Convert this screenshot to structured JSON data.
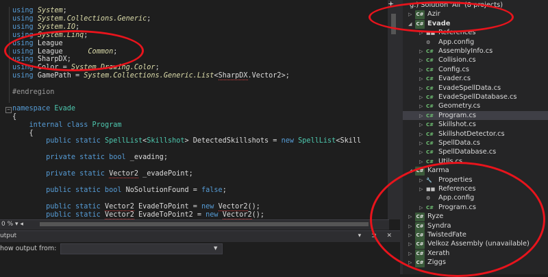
{
  "editor": {
    "lines": [
      [
        {
          "t": "using ",
          "c": "kw"
        },
        {
          "t": "System",
          "c": "ns"
        },
        {
          "t": ";",
          "c": "df"
        }
      ],
      [
        {
          "t": "using ",
          "c": "kw"
        },
        {
          "t": "System.Collections.Generic",
          "c": "ns"
        },
        {
          "t": ";",
          "c": "df"
        }
      ],
      [
        {
          "t": "using ",
          "c": "kw"
        },
        {
          "t": "System.IO",
          "c": "ns"
        },
        {
          "t": ";",
          "c": "df"
        }
      ],
      [
        {
          "t": "using ",
          "c": "kw"
        },
        {
          "t": "System.Linq",
          "c": "ns"
        },
        {
          "t": ";",
          "c": "df"
        }
      ],
      [
        {
          "t": "using ",
          "c": "kw"
        },
        {
          "t": "League",
          "c": "df"
        }
      ],
      [
        {
          "t": "using ",
          "c": "kw"
        },
        {
          "t": "League      ",
          "c": "df"
        },
        {
          "t": "Common",
          "c": "ns"
        },
        {
          "t": ";",
          "c": "df"
        }
      ],
      [
        {
          "t": "using ",
          "c": "kw"
        },
        {
          "t": "SharpDX",
          "c": "df"
        },
        {
          "t": ";",
          "c": "df"
        }
      ],
      [
        {
          "t": "using ",
          "c": "kw"
        },
        {
          "t": "Color = ",
          "c": "df"
        },
        {
          "t": "System.Drawing.Color",
          "c": "ns"
        },
        {
          "t": ";",
          "c": "df"
        }
      ],
      [
        {
          "t": "using ",
          "c": "kw"
        },
        {
          "t": "GamePath = ",
          "c": "df"
        },
        {
          "t": "System.Collections.Generic.List",
          "c": "ns"
        },
        {
          "t": "<",
          "c": "df"
        },
        {
          "t": "SharpDX",
          "c": "df",
          "u": true
        },
        {
          "t": ".Vector2>;",
          "c": "df"
        }
      ],
      [],
      [
        {
          "t": "#endregion",
          "c": "cm"
        }
      ],
      [],
      [
        {
          "t": "namespace ",
          "c": "kw"
        },
        {
          "t": "Evade",
          "c": "ty"
        }
      ],
      [
        {
          "t": "{",
          "c": "df"
        }
      ],
      [
        {
          "t": "    internal class ",
          "c": "kw"
        },
        {
          "t": "Program",
          "c": "ty"
        }
      ],
      [
        {
          "t": "    {",
          "c": "df"
        }
      ],
      [
        {
          "t": "        public static ",
          "c": "kw"
        },
        {
          "t": "SpellList",
          "c": "ty"
        },
        {
          "t": "<",
          "c": "df"
        },
        {
          "t": "Skillshot",
          "c": "ty"
        },
        {
          "t": "> DetectedSkillshots = ",
          "c": "df"
        },
        {
          "t": "new ",
          "c": "kw"
        },
        {
          "t": "SpellList",
          "c": "ty"
        },
        {
          "t": "<Skill",
          "c": "df"
        }
      ],
      [],
      [
        {
          "t": "        private static bool ",
          "c": "kw"
        },
        {
          "t": "_evading;",
          "c": "df"
        }
      ],
      [],
      [
        {
          "t": "        private static ",
          "c": "kw"
        },
        {
          "t": "Vector2",
          "c": "df",
          "u": true
        },
        {
          "t": " _evadePoint;",
          "c": "df"
        }
      ],
      [],
      [
        {
          "t": "        public static bool ",
          "c": "kw"
        },
        {
          "t": "NoSolutionFound = ",
          "c": "df"
        },
        {
          "t": "false",
          "c": "kw"
        },
        {
          "t": ";",
          "c": "df"
        }
      ],
      [],
      [
        {
          "t": "        public static ",
          "c": "kw"
        },
        {
          "t": "Vector2",
          "c": "df",
          "u": true
        },
        {
          "t": " EvadeToPoint = ",
          "c": "df"
        },
        {
          "t": "new ",
          "c": "kw"
        },
        {
          "t": "Vector2",
          "c": "df",
          "u": true
        },
        {
          "t": "();",
          "c": "df"
        }
      ],
      [
        {
          "t": "        public static ",
          "c": "kw"
        },
        {
          "t": "Vector2",
          "c": "df",
          "u": true
        },
        {
          "t": " EvadeToPoint2 = ",
          "c": "df"
        },
        {
          "t": "new ",
          "c": "kw"
        },
        {
          "t": "Vector2",
          "c": "df",
          "u": true
        },
        {
          "t": "();",
          "c": "df"
        }
      ]
    ]
  },
  "statusbar": {
    "zoom": "0 %"
  },
  "output": {
    "title": "utput",
    "buttons": "▾ ⊐ ✕",
    "show_from_label": "how output from:",
    "show_from_value": ""
  },
  "solution_explorer": {
    "items": [
      {
        "label": "g.) Solution 'All' (8 projects)",
        "arrow": "",
        "icon": "",
        "indent": 0
      },
      {
        "label": "Azir",
        "arrow": "▷",
        "icon": "C#",
        "kind": "proj",
        "indent": 1
      },
      {
        "label": "Evade",
        "arrow": "◢",
        "icon": "C#",
        "kind": "proj",
        "indent": 1,
        "bold": true
      },
      {
        "label": "References",
        "arrow": "▷",
        "icon": "■■",
        "kind": "wr",
        "indent": 2
      },
      {
        "label": "App.config",
        "arrow": "",
        "icon": "⚙",
        "kind": "cfg",
        "indent": 2
      },
      {
        "label": "AssemblyInfo.cs",
        "arrow": "▷",
        "icon": "C#",
        "kind": "cs",
        "indent": 2
      },
      {
        "label": "Collision.cs",
        "arrow": "▷",
        "icon": "C#",
        "kind": "cs",
        "indent": 2
      },
      {
        "label": "Config.cs",
        "arrow": "▷",
        "icon": "C#",
        "kind": "cs",
        "indent": 2
      },
      {
        "label": "Evader.cs",
        "arrow": "▷",
        "icon": "C#",
        "kind": "cs",
        "indent": 2
      },
      {
        "label": "EvadeSpellData.cs",
        "arrow": "▷",
        "icon": "C#",
        "kind": "cs",
        "indent": 2
      },
      {
        "label": "EvadeSpellDatabase.cs",
        "arrow": "▷",
        "icon": "C#",
        "kind": "cs",
        "indent": 2
      },
      {
        "label": "Geometry.cs",
        "arrow": "▷",
        "icon": "C#",
        "kind": "cs",
        "indent": 2
      },
      {
        "label": "Program.cs",
        "arrow": "▷",
        "icon": "C#",
        "kind": "cs",
        "indent": 2,
        "selected": true
      },
      {
        "label": "Skillshot.cs",
        "arrow": "▷",
        "icon": "C#",
        "kind": "cs",
        "indent": 2
      },
      {
        "label": "SkillshotDetector.cs",
        "arrow": "▷",
        "icon": "C#",
        "kind": "cs",
        "indent": 2
      },
      {
        "label": "SpellData.cs",
        "arrow": "▷",
        "icon": "C#",
        "kind": "cs",
        "indent": 2
      },
      {
        "label": "SpellDatabase.cs",
        "arrow": "▷",
        "icon": "C#",
        "kind": "cs",
        "indent": 2
      },
      {
        "label": "Utils.cs",
        "arrow": "▷",
        "icon": "C#",
        "kind": "cs",
        "indent": 2
      },
      {
        "label": "Karma",
        "arrow": "◢",
        "icon": "C#",
        "kind": "proj",
        "indent": 1
      },
      {
        "label": "Properties",
        "arrow": "▷",
        "icon": "🔧",
        "kind": "wr",
        "indent": 2
      },
      {
        "label": "References",
        "arrow": "▷",
        "icon": "■■",
        "kind": "wr",
        "indent": 2
      },
      {
        "label": "App.config",
        "arrow": "",
        "icon": "⚙",
        "kind": "cfg",
        "indent": 2
      },
      {
        "label": "Program.cs",
        "arrow": "▷",
        "icon": "C#",
        "kind": "cs",
        "indent": 2
      },
      {
        "label": "Ryze",
        "arrow": "▷",
        "icon": "C#",
        "kind": "proj",
        "indent": 1
      },
      {
        "label": "Syndra",
        "arrow": "▷",
        "icon": "C#",
        "kind": "proj",
        "indent": 1
      },
      {
        "label": "TwistedFate",
        "arrow": "▷",
        "icon": "C#",
        "kind": "proj",
        "indent": 1
      },
      {
        "label": "Velkoz Assembly (unavailable)",
        "arrow": "▷",
        "icon": "C#",
        "kind": "proj",
        "indent": 1
      },
      {
        "label": "Xerath",
        "arrow": "▷",
        "icon": "C#",
        "kind": "proj",
        "indent": 1
      },
      {
        "label": "Ziggs",
        "arrow": "▷",
        "icon": "C#",
        "kind": "proj",
        "indent": 1
      }
    ]
  },
  "colors": {
    "annotation": "#e8141c",
    "keyword": "#569cd6",
    "type": "#4ec9b0",
    "namespace": "#dcdcaa"
  }
}
